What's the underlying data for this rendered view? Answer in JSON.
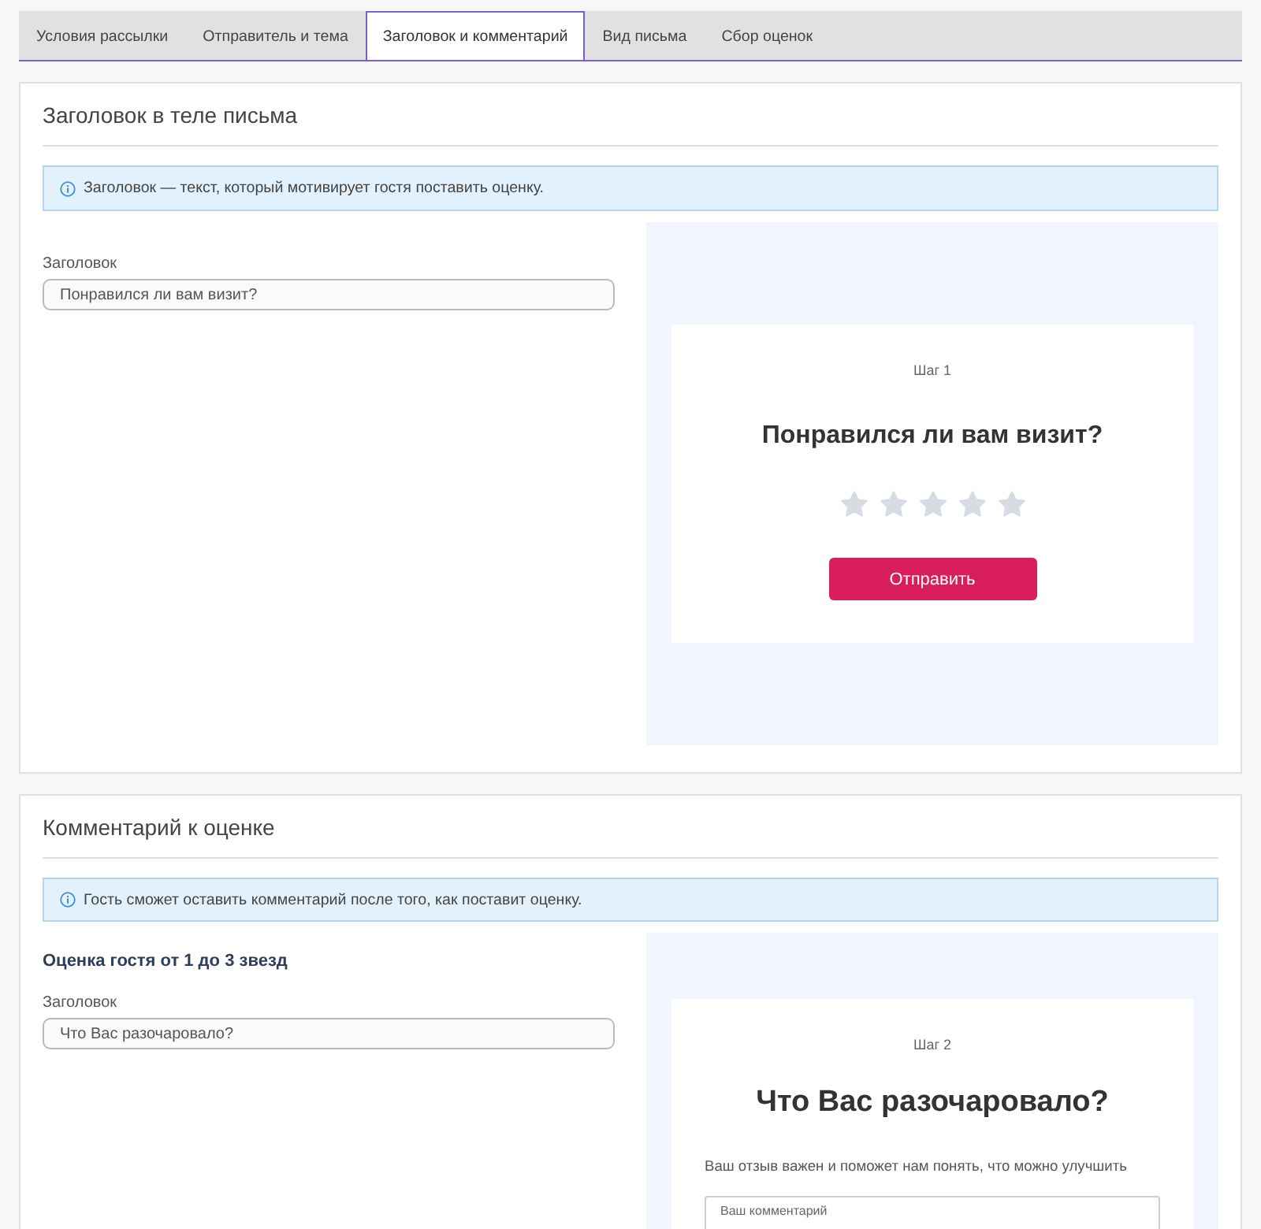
{
  "tabs": [
    {
      "label": "Условия рассылки",
      "selected": false
    },
    {
      "label": "Отправитель и тема",
      "selected": false
    },
    {
      "label": "Заголовок и комментарий",
      "selected": true
    },
    {
      "label": "Вид письма",
      "selected": false
    },
    {
      "label": "Сбор оценок",
      "selected": false
    }
  ],
  "sections": [
    {
      "title": "Заголовок в теле письма",
      "info": "Заголовок — текст, который мотивирует гостя поставить оценку.",
      "field": {
        "label": "Заголовок",
        "value": "Понравился ли вам визит?"
      },
      "preview": {
        "kind": "rating",
        "step": "Шаг 1",
        "heading": "Понравился ли вам визит?",
        "stars": 0,
        "button": "Отправить"
      }
    },
    {
      "title": "Комментарий к оценке",
      "info": "Гость сможет оставить комментарий после того, как поставит оценку.",
      "heading": "Оценка гостя от 1 до 3 звезд",
      "field": {
        "label": "Заголовок",
        "value": "Что Вас разочаровало?"
      },
      "preview": {
        "kind": "comment",
        "step": "Шаг 2",
        "heading": "Что Вас разочаровало?",
        "text": "Ваш отзыв важен и поможет нам понять, что можно улучшить",
        "comment_box": {
          "placeholder": "Ваш комментарий"
        }
      }
    }
  ]
}
